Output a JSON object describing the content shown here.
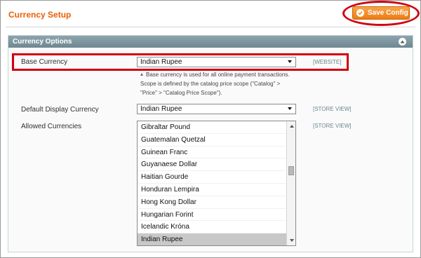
{
  "header": {
    "title": "Currency Setup",
    "save_label": "Save Config"
  },
  "section": {
    "title": "Currency Options"
  },
  "fields": {
    "base_currency": {
      "label": "Base Currency",
      "value": "Indian Rupee",
      "scope": "[WEBSITE]",
      "note": "Base currency is used for all online payment transactions. Scope is defined by the catalog price scope (\"Catalog\" > \"Price\" > \"Catalog Price Scope\")."
    },
    "default_display": {
      "label": "Default Display Currency",
      "value": "Indian Rupee",
      "scope": "[STORE VIEW]"
    },
    "allowed": {
      "label": "Allowed Currencies",
      "scope": "[STORE VIEW]",
      "options": [
        "Gibraltar Pound",
        "Guatemalan Quetzal",
        "Guinean Franc",
        "Guyanaese Dollar",
        "Haitian Gourde",
        "Honduran Lempira",
        "Hong Kong Dollar",
        "Hungarian Forint",
        "Icelandic Króna",
        "Indian Rupee"
      ],
      "selected": "Indian Rupee"
    }
  },
  "colors": {
    "title": "#eb5e00",
    "button": "#ee7b12",
    "section_header": "#7d959e",
    "highlight": "#d0000f",
    "scope_text": "#6d8691"
  }
}
